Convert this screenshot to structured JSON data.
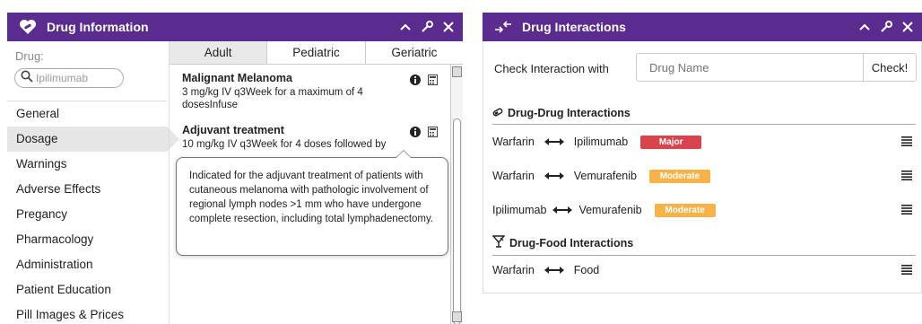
{
  "drug_info": {
    "title": "Drug Information",
    "drug_label": "Drug:",
    "search_value": "Ipilimumab",
    "nav": [
      {
        "label": "General"
      },
      {
        "label": "Dosage"
      },
      {
        "label": "Warnings"
      },
      {
        "label": "Adverse Effects"
      },
      {
        "label": "Pregancy"
      },
      {
        "label": "Pharmacology"
      },
      {
        "label": "Administration"
      },
      {
        "label": "Patient Education"
      },
      {
        "label": "Pill Images & Prices"
      }
    ],
    "active_nav": "Dosage",
    "tabs": [
      {
        "label": "Adult"
      },
      {
        "label": "Pediatric"
      },
      {
        "label": "Geriatric"
      }
    ],
    "active_tab": "Adult",
    "doses": [
      {
        "title": "Malignant Melanoma",
        "text": "3 mg/kg IV q3Week for a maximum of 4 dosesInfuse"
      },
      {
        "title": "Adjuvant treatment",
        "text": "10 mg/kg IV q3Week for 4 doses followed by"
      }
    ],
    "tooltip": "Indicated for the adjuvant treatment of patients with cutaneous melanoma with pathologic involvement of regional lymph nodes >1 mm who have undergone complete resection, including total lymphadenectomy."
  },
  "interactions": {
    "title": "Drug Interactions",
    "check_label": "Check Interaction with",
    "input_placeholder": "Drug Name",
    "check_button": "Check!",
    "drug_drug_title": "Drug-Drug Interactions",
    "drug_drug": [
      {
        "a": "Warfarin",
        "b": "Ipilimumab",
        "severity": "Major",
        "color": "#d9434e"
      },
      {
        "a": "Warfarin",
        "b": "Vemurafenib",
        "severity": "Moderate",
        "color": "#f7b34a"
      },
      {
        "a": "Ipilimumab",
        "b": "Vemurafenib",
        "severity": "Moderate",
        "color": "#f7b34a"
      }
    ],
    "drug_food_title": "Drug-Food Interactions",
    "drug_food": [
      {
        "a": "Warfarin",
        "b": "Food"
      }
    ]
  },
  "colors": {
    "titlebar": "#5b2c8f",
    "major": "#d9434e",
    "moderate": "#f7b34a"
  },
  "icons": [
    "heart-pill-icon",
    "chevron-up-icon",
    "wrench-icon",
    "close-icon",
    "search-icon",
    "info-icon",
    "calculator-icon",
    "interaction-arrows-icon",
    "pill-icon",
    "food-icon",
    "menu-icon",
    "double-arrow-icon"
  ]
}
